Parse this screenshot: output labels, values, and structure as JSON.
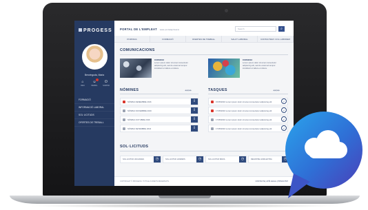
{
  "app": {
    "logo": "PROGESS",
    "portal_title": "PORTAL DE L'EMPLEAT",
    "portal_subtitle": "www.portalaplicacio",
    "search_placeholder": "Search",
    "search_icon": "search-icon"
  },
  "sidebar": {
    "user_name": "Benvinguda, Maria",
    "icons": [
      {
        "name": "home-icon",
        "label": "INICI"
      },
      {
        "name": "user-icon",
        "label": "PERFIL"
      },
      {
        "name": "power-icon",
        "label": "SORTIR"
      }
    ],
    "nav": [
      "FORMACIÓ",
      "INFORMACIÓ LABORAL",
      "SOL·LICITUDS",
      "OFERTES DE TREBALL"
    ]
  },
  "topnav": [
    "PORTADA",
    "FORMACIÓ",
    "OFERTES DE TREBALL",
    "SALUT LABORAL",
    "CONTACTEM I COL·LABOREM"
  ],
  "comunicacions": {
    "title": "COMUNICACIONS",
    "items": [
      {
        "date": "15/05/2016",
        "text": "Lorem ipsum dolor sit amet consectetur adipiscing elit, sed do eiusmod tempor incididunt ut labore et dolore."
      },
      {
        "date": "15/05/2016",
        "text": "Lorem ipsum dolor sit amet consectetur adipiscing elit, sed do eiusmod tempor incididunt ut labore et dolore."
      }
    ]
  },
  "nomines": {
    "title": "NÒMINES",
    "ctrl": "◀◀ ▶▶",
    "rows": [
      {
        "text": "NÒMINA DESEMBRE 2016",
        "color": "#d9342b",
        "action_icon": "download-icon"
      },
      {
        "text": "NÒMINA NOVEMBRE 2016",
        "color": "#9aa2b2",
        "action_icon": "download-icon"
      },
      {
        "text": "NÒMINA OCTUBRE 2016",
        "color": "#9aa2b2",
        "action_icon": "download-icon"
      },
      {
        "text": "NÒMINA SETEMBRE 2016",
        "color": "#9aa2b2",
        "action_icon": "download-icon"
      }
    ]
  },
  "tasques": {
    "title": "TASQUES",
    "ctrl": "◀◀ ▶▶",
    "rows": [
      {
        "text": "15/05/2016  Lorem ipsum dolor sit amet consectetur adipiscing elit",
        "color": "#d9342b"
      },
      {
        "text": "17/05/2016  Lorem ipsum dolor sit amet consectetur adipiscing elit",
        "color": "#d9342b"
      },
      {
        "text": "17/05/2016  Lorem ipsum dolor sit amet consectetur adipiscing elit",
        "color": "#9aa2b2"
      },
      {
        "text": "17/05/2016  Lorem ipsum dolor sit amet consectetur adipiscing elit",
        "color": "#9aa2b2"
      }
    ]
  },
  "sollicituds": {
    "title": "SOL·LICITUDS",
    "items": [
      "SOL·LICITUD VACANCES",
      "SOL·LICITUD HORARIS",
      "SOL·LICITUD BAIXA",
      "REGISTRE HORA EXTRA"
    ]
  },
  "footer": {
    "left": "COPYRIGHT © PROGESS. TOTS ELS DRETS RESERVATS.",
    "right": "CONTACTE  |  AVÍS LEGAL  |  PRIVACITAT"
  },
  "colors": {
    "navy": "#263a61",
    "accent": "#2f4a7d",
    "bubble": "#2b8fe0",
    "bubble_dark": "#4b3fb8"
  },
  "bubble_icon": "cloud-icon"
}
